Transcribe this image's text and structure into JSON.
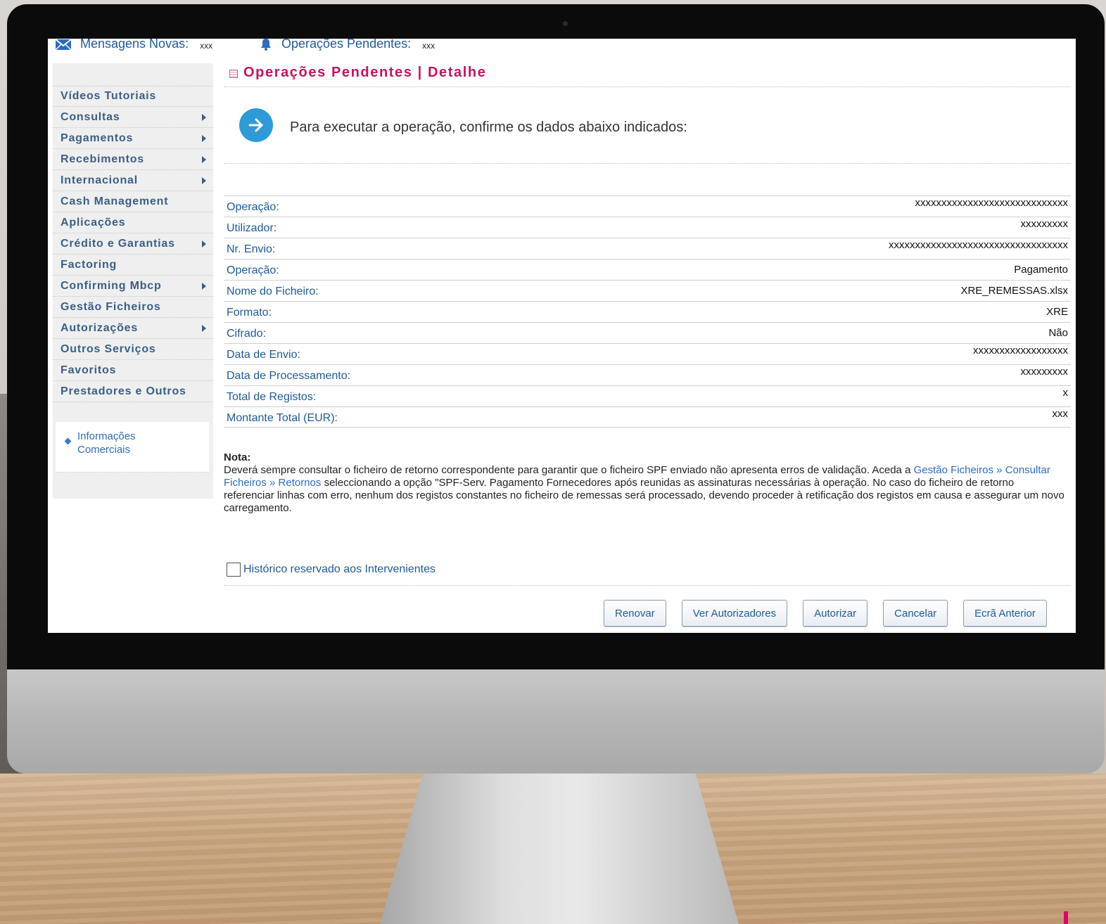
{
  "topbar": {
    "messages_label": "Mensagens Novas:",
    "messages_count": "xxx",
    "pending_label": "Operações Pendentes:",
    "pending_count": "xxx"
  },
  "sidebar": {
    "items": [
      {
        "label": "Vídeos Tutoriais",
        "submenu": false
      },
      {
        "label": "Consultas",
        "submenu": true
      },
      {
        "label": "Pagamentos",
        "submenu": true
      },
      {
        "label": "Recebimentos",
        "submenu": true
      },
      {
        "label": "Internacional",
        "submenu": true
      },
      {
        "label": "Cash Management",
        "submenu": false
      },
      {
        "label": "Aplicações",
        "submenu": false
      },
      {
        "label": "Crédito e Garantias",
        "submenu": true
      },
      {
        "label": "Factoring",
        "submenu": false
      },
      {
        "label": "Confirming Mbcp",
        "submenu": true
      },
      {
        "label": "Gestão Ficheiros",
        "submenu": false
      },
      {
        "label": "Autorizações",
        "submenu": true
      },
      {
        "label": "Outros Serviços",
        "submenu": false
      },
      {
        "label": "Favoritos",
        "submenu": false
      },
      {
        "label": "Prestadores e Outros",
        "submenu": false
      }
    ],
    "info_link": "Informações Comerciais"
  },
  "main": {
    "title": "Operações Pendentes | Detalhe",
    "confirm_text": "Para executar a operação, confirme os dados abaixo indicados:",
    "details": [
      {
        "label": "Operação:",
        "value": "xxxxxxxxxxxxxxxxxxxxxxxxxxxxx"
      },
      {
        "label": "Utilizador:",
        "value": "xxxxxxxxx"
      },
      {
        "label": "Nr. Envio:",
        "value": "xxxxxxxxxxxxxxxxxxxxxxxxxxxxxxxxxx"
      },
      {
        "label": "Operação:",
        "value": "Pagamento"
      },
      {
        "label": "Nome do Ficheiro:",
        "value": "XRE_REMESSAS.xlsx"
      },
      {
        "label": "Formato:",
        "value": "XRE"
      },
      {
        "label": "Cifrado:",
        "value": "Não"
      },
      {
        "label": "Data de Envio:",
        "value": "xxxxxxxxxxxxxxxxxx"
      },
      {
        "label": "Data de Processamento:",
        "value": "xxxxxxxxx"
      },
      {
        "label": "Total de Registos:",
        "value": "x"
      },
      {
        "label": "Montante Total (EUR):",
        "value": "xxx"
      }
    ],
    "nota": {
      "heading": "Nota:",
      "text_1": "Deverá sempre consultar o ficheiro de retorno correspondente para garantir que o ficheiro SPF enviado não apresenta erros de validação. Aceda a ",
      "link": "Gestão Ficheiros » Consultar Ficheiros » Retornos",
      "text_2": " seleccionando a opção \"SPF-Serv. Pagamento Fornecedores após reunidas as assinaturas necessárias à operação. No caso do ficheiro de retorno referenciar linhas com erro, nenhum dos registos constantes no ficheiro de remessas será processado, devendo proceder à retificação dos registos em causa e assegurar um novo carregamento."
    },
    "historico_label": "Histórico reservado aos Intervenientes",
    "buttons": {
      "renovar": "Renovar",
      "ver_autorizadores": "Ver Autorizadores",
      "autorizar": "Autorizar",
      "cancelar": "Cancelar",
      "ecra_anterior": "Ecrã Anterior"
    }
  },
  "colors": {
    "title": "#c4145c",
    "link": "#2d6cc0",
    "menu": "#3a5f86",
    "accent_circle": "#2e9ad8"
  }
}
